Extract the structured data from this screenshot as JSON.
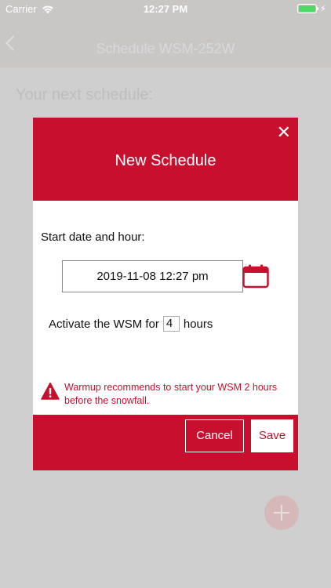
{
  "status_bar": {
    "carrier": "Carrier",
    "time": "12:27 PM",
    "battery_level": 1.0,
    "wifi_icon": "wifi-icon",
    "charging_icon": "bolt-icon"
  },
  "nav": {
    "title": "Schedule WSM-252W",
    "back_icon": "chevron-left-icon"
  },
  "background": {
    "heading": "Your next schedule:",
    "fab_icon": "plus-icon"
  },
  "modal": {
    "title": "New Schedule",
    "close_symbol": "✕",
    "start_label": "Start date and hour:",
    "date_value": "2019-11-08 12:27 pm",
    "calendar_icon": "calendar-icon",
    "activate_prefix": "Activate the WSM for",
    "hours_value": "4",
    "activate_suffix": "hours",
    "warning_icon": "warning-icon",
    "warning_text": "Warmup recommends to start your WSM 2 hours before the snowfall.",
    "cancel_label": "Cancel",
    "save_label": "Save"
  },
  "colors": {
    "accent": "#c8102e",
    "overlay": "#cfcfcf",
    "battery": "#4cd964"
  }
}
